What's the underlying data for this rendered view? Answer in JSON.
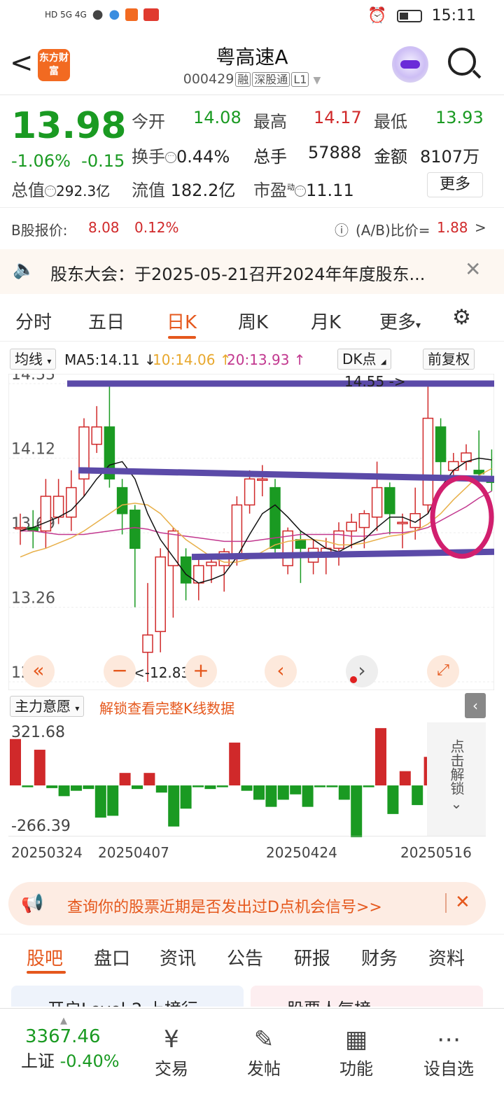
{
  "status": {
    "carrier": "HD 5G 4G",
    "time": "15:11"
  },
  "header": {
    "back": "<",
    "logo": "东方财富",
    "title": "粤高速A",
    "code": "000429",
    "tags": [
      "融",
      "深股通",
      "L1"
    ]
  },
  "quote": {
    "price": "13.98",
    "pct": "-1.06%",
    "chg": "-0.15",
    "open_label": "今开",
    "open": "14.08",
    "high_label": "最高",
    "high": "14.17",
    "low_label": "最低",
    "low": "13.93",
    "turnover_label": "换手",
    "turnover": "0.44%",
    "vol_label": "总手",
    "vol": "57888",
    "amt_label": "金额",
    "amt": "8107万",
    "mcap_label": "总值",
    "mcap": "292.3亿",
    "float_label": "流值",
    "float": "182.2亿",
    "pe_label": "市盈",
    "pe_sup": "动",
    "pe": "11.11",
    "more": "更多"
  },
  "bshare": {
    "label": "B股报价:",
    "price": "8.08",
    "pct": "0.12%",
    "ratio_label": "(A/B)比价=",
    "ratio": "1.88",
    "arrow": ">"
  },
  "notice": {
    "text": "股东大会：于2025-05-21召开2024年年度股东..."
  },
  "tabs": [
    "分时",
    "五日",
    "日K",
    "周K",
    "月K",
    "更多"
  ],
  "toolbar": {
    "ma_select": "均线",
    "ma5": "MA5:14.11 ↓",
    "ma10": "10:14.06 ↑",
    "ma20": "20:13.93 ↑",
    "dk": "DK点",
    "fq": "前复权"
  },
  "chart_data": {
    "type": "candlestick",
    "y_ticks": [
      "14.55",
      "14.12",
      "13.69",
      "13.26",
      "12.83"
    ],
    "ylim": [
      12.83,
      14.55
    ],
    "annotations": {
      "max": "14.55 ->",
      "min": "<-12.83"
    },
    "x_labels": [
      "20250324",
      "20250407",
      "20250424",
      "20250516"
    ],
    "candles": [
      [
        13.72,
        13.72,
        13.62,
        13.8
      ],
      [
        13.72,
        13.7,
        13.6,
        13.82
      ],
      [
        13.7,
        13.9,
        13.6,
        14.0
      ],
      [
        13.78,
        13.9,
        13.74,
        14.0
      ],
      [
        13.78,
        13.95,
        13.7,
        14.05
      ],
      [
        14.0,
        14.3,
        13.9,
        14.35
      ],
      [
        14.2,
        14.3,
        14.15,
        14.42
      ],
      [
        14.3,
        14.0,
        13.95,
        14.55
      ],
      [
        13.95,
        13.8,
        13.68,
        14.0
      ],
      [
        13.82,
        13.6,
        13.26,
        13.85
      ],
      [
        13.0,
        13.1,
        12.83,
        13.4
      ],
      [
        13.12,
        13.55,
        13.0,
        13.6
      ],
      [
        13.5,
        13.7,
        13.2,
        13.72
      ],
      [
        13.55,
        13.4,
        13.3,
        13.6
      ],
      [
        13.4,
        13.5,
        13.3,
        13.55
      ],
      [
        13.5,
        13.52,
        13.4,
        13.55
      ],
      [
        13.5,
        13.58,
        13.35,
        13.6
      ],
      [
        13.55,
        13.85,
        13.5,
        13.9
      ],
      [
        13.85,
        14.0,
        13.8,
        14.05
      ],
      [
        14.0,
        14.0,
        13.9,
        14.08
      ],
      [
        13.95,
        13.6,
        13.55,
        14.0
      ],
      [
        13.5,
        13.7,
        13.45,
        13.72
      ],
      [
        13.65,
        13.6,
        13.4,
        13.7
      ],
      [
        13.52,
        13.6,
        13.45,
        13.65
      ],
      [
        13.55,
        13.6,
        13.45,
        13.66
      ],
      [
        13.6,
        13.7,
        13.5,
        13.75
      ],
      [
        13.7,
        13.75,
        13.6,
        13.8
      ],
      [
        13.72,
        13.8,
        13.6,
        13.82
      ],
      [
        13.78,
        13.95,
        13.7,
        14.1
      ],
      [
        13.95,
        13.8,
        13.68,
        13.98
      ],
      [
        13.75,
        13.75,
        13.6,
        13.8
      ],
      [
        13.72,
        13.8,
        13.65,
        13.95
      ],
      [
        13.85,
        14.35,
        13.8,
        14.55
      ],
      [
        14.3,
        14.1,
        14.0,
        14.35
      ],
      [
        14.05,
        14.1,
        14.0,
        14.15
      ],
      [
        14.1,
        14.15,
        14.05,
        14.2
      ],
      [
        14.05,
        14.03,
        13.95,
        14.28
      ],
      [
        14.0,
        13.98,
        13.93,
        14.17
      ]
    ],
    "ma5": [
      13.7,
      13.72,
      13.75,
      13.78,
      13.82,
      13.9,
      14.0,
      14.08,
      14.1,
      14.0,
      13.8,
      13.65,
      13.55,
      13.45,
      13.4,
      13.42,
      13.45,
      13.55,
      13.68,
      13.8,
      13.85,
      13.78,
      13.7,
      13.65,
      13.6,
      13.58,
      13.62,
      13.65,
      13.72,
      13.78,
      13.78,
      13.75,
      13.8,
      13.95,
      14.05,
      14.1,
      14.12,
      14.11
    ],
    "ma10": [
      13.55,
      13.58,
      13.6,
      13.63,
      13.66,
      13.7,
      13.75,
      13.8,
      13.85,
      13.86,
      13.85,
      13.8,
      13.72,
      13.65,
      13.6,
      13.55,
      13.52,
      13.52,
      13.54,
      13.58,
      13.62,
      13.64,
      13.65,
      13.65,
      13.64,
      13.62,
      13.62,
      13.63,
      13.65,
      13.67,
      13.68,
      13.7,
      13.74,
      13.8,
      13.88,
      13.95,
      14.02,
      14.06
    ],
    "ma20": [
      13.7,
      13.7,
      13.69,
      13.68,
      13.68,
      13.68,
      13.69,
      13.7,
      13.71,
      13.72,
      13.71,
      13.69,
      13.68,
      13.67,
      13.66,
      13.65,
      13.64,
      13.64,
      13.64,
      13.65,
      13.66,
      13.67,
      13.68,
      13.68,
      13.68,
      13.68,
      13.67,
      13.67,
      13.68,
      13.69,
      13.69,
      13.7,
      13.72,
      13.76,
      13.8,
      13.84,
      13.89,
      13.93
    ],
    "ma_colors": {
      "ma5": "#111111",
      "ma10": "#e8b04a",
      "ma20": "#c2388f"
    },
    "up_color": "#d0292a",
    "down_color": "#1a9a22"
  },
  "indicator": {
    "select": "主力意愿",
    "lock_text": "解锁查看完整K线数据",
    "max": "321.68",
    "min": "-266.39",
    "unlock": "点击解锁",
    "values": [
      260,
      -10,
      200,
      -15,
      -60,
      -30,
      -20,
      -180,
      -170,
      70,
      -20,
      70,
      -40,
      -230,
      -130,
      -10,
      -20,
      -10,
      240,
      -30,
      -80,
      -120,
      -80,
      -50,
      -120,
      -10,
      -10,
      -80,
      -340,
      -10,
      321,
      -160,
      80,
      -110,
      160
    ]
  },
  "dsignal": {
    "text": "查询你的股票近期是否发出过D点机会信号>>"
  },
  "bottom_tabs": [
    "股吧",
    "盘口",
    "资讯",
    "公告",
    "研报",
    "财务",
    "资料"
  ],
  "cards": [
    "开启Level-2 上榜行...",
    "股票人气榜"
  ],
  "nav": {
    "index_value": "3367.46",
    "index_name": "上证",
    "index_pct": "-0.40%",
    "items": [
      "交易",
      "发帖",
      "功能",
      "设自选"
    ]
  }
}
